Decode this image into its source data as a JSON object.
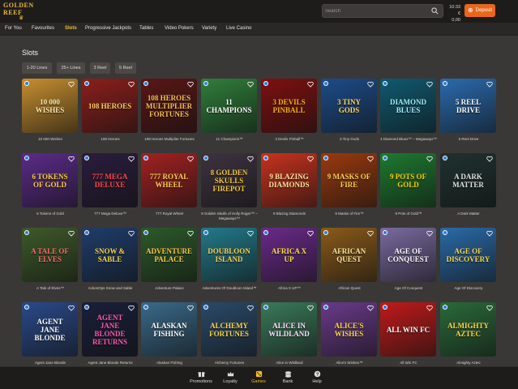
{
  "header": {
    "logo_text": "GOLDEN REEF",
    "search_placeholder": "Search",
    "balance_time": "10:33",
    "balance_amount": "€ 0,00",
    "deposit_label": "Deposit"
  },
  "nav": {
    "tabs": [
      {
        "label": "For You"
      },
      {
        "label": "Favourites"
      },
      {
        "label": "Slots",
        "active": true
      },
      {
        "label": "Progressive Jackpots"
      },
      {
        "label": "Tables"
      },
      {
        "label": "Video Pokers"
      },
      {
        "label": "Variety"
      },
      {
        "label": "Live Casino"
      }
    ]
  },
  "section": {
    "title": "Slots",
    "filters": [
      "1-20 Lines",
      "25+ Lines",
      "3 Reel",
      "5 Reel"
    ]
  },
  "games": [
    {
      "name": "10 000 Wishes",
      "art": "10 000 WISHES",
      "bg": "#c78f2f",
      "fg": "#ffe9a8"
    },
    {
      "name": "108 Heroes",
      "art": "108 HEROES",
      "bg": "#8c1f1b",
      "fg": "#ffd15a"
    },
    {
      "name": "108 Heroes Multiplier Fortunes",
      "art": "108 HEROES MULTIPLIER FORTUNES",
      "bg": "#5a1616",
      "fg": "#f6c24a"
    },
    {
      "name": "11 Champions™",
      "art": "11 CHAMPIONS",
      "bg": "#2f7f3a",
      "fg": "#ffffff"
    },
    {
      "name": "3 Devils Pinball™",
      "art": "3 DEVILS PINBALL",
      "bg": "#7e1010",
      "fg": "#ffb400"
    },
    {
      "name": "3 Tiny Gods",
      "art": "3 TINY GODS",
      "bg": "#1d4c8a",
      "fg": "#ffd86b"
    },
    {
      "name": "4 Diamond Blues™ – Megaways™",
      "art": "DIAMOND BLUES",
      "bg": "#0f5a70",
      "fg": "#9ef0ff"
    },
    {
      "name": "5 Reel Drive",
      "art": "5 REEL DRIVE",
      "bg": "#2a6bb0",
      "fg": "#ffffff"
    },
    {
      "name": "6 Tokens of Gold",
      "art": "6 TOKENS OF GOLD",
      "bg": "#5b2b8a",
      "fg": "#ffcf3a"
    },
    {
      "name": "777 Mega Deluxe™",
      "art": "777 MEGA DELUXE",
      "bg": "#2a1d3e",
      "fg": "#ff4a4a"
    },
    {
      "name": "777 Royal Wheel",
      "art": "777 ROYAL WHEEL",
      "bg": "#a32121",
      "fg": "#ffd34d"
    },
    {
      "name": "8 Golden Skulls of Holly Roger™ – Megaways™",
      "art": "8 GOLDEN SKULLS FIREPOT",
      "bg": "#3d3340",
      "fg": "#f4c542"
    },
    {
      "name": "9 Blazing Diamonds",
      "art": "9 BLAZING DIAMONDS",
      "bg": "#c8321e",
      "fg": "#ffe7a0"
    },
    {
      "name": "9 Masks of Fire™",
      "art": "9 MASKS OF FIRE",
      "bg": "#9a3a0f",
      "fg": "#ffd24a"
    },
    {
      "name": "9 Pots of Gold™",
      "art": "9 POTS OF GOLD",
      "bg": "#1e7a30",
      "fg": "#ffd400"
    },
    {
      "name": "A Dark Matter",
      "art": "A DARK MATTER",
      "bg": "#1f3230",
      "fg": "#e0e0e0"
    },
    {
      "name": "A Tale of Elves™",
      "art": "A TALE OF ELVES",
      "bg": "#3d5a2a",
      "fg": "#ff6b6b"
    },
    {
      "name": "ActionOps Snow and Sable",
      "art": "SNOW & SABLE",
      "bg": "#1f3d6b",
      "fg": "#ffd84a"
    },
    {
      "name": "Adventure Palace",
      "art": "ADVENTURE PALACE",
      "bg": "#2c5a2a",
      "fg": "#ffca3a"
    },
    {
      "name": "Adventures Of Doubloon Island™",
      "art": "DOUBLOON ISLAND",
      "bg": "#227a8a",
      "fg": "#ffd34d"
    },
    {
      "name": "Africa X UP™",
      "art": "AFRICA X UP",
      "bg": "#6a2a8a",
      "fg": "#ffe14a"
    },
    {
      "name": "African Quest",
      "art": "AFRICAN QUEST",
      "bg": "#8a5a1a",
      "fg": "#ffe7a0"
    },
    {
      "name": "Age Of Conquest",
      "art": "AGE OF CONQUEST",
      "bg": "#7a6aa0",
      "fg": "#ffffff"
    },
    {
      "name": "Age Of Discovery",
      "art": "AGE OF DISCOVERY",
      "bg": "#2a6aa8",
      "fg": "#ffd84a"
    },
    {
      "name": "Agent Jane Blonde",
      "art": "AGENT JANE BLONDE",
      "bg": "#2a4a8a",
      "fg": "#ffffff"
    },
    {
      "name": "Agent Jane Blonde Returns",
      "art": "AGENT JANE BLONDE RETURNS",
      "bg": "#1a1f3a",
      "fg": "#ff5ab0"
    },
    {
      "name": "Alaskan Fishing",
      "art": "ALASKAN FISHING",
      "bg": "#3a6a8a",
      "fg": "#ffffff"
    },
    {
      "name": "Alchemy Fortunes",
      "art": "ALCHEMY FORTUNES",
      "bg": "#2a4a6a",
      "fg": "#ffd84a"
    },
    {
      "name": "Alice in Wildland",
      "art": "ALICE IN WILDLAND",
      "bg": "#3a7a5a",
      "fg": "#ffe0ff"
    },
    {
      "name": "Alice's Wishes™",
      "art": "ALICE'S WISHES",
      "bg": "#6a3a8a",
      "fg": "#ffd84a"
    },
    {
      "name": "All Win FC",
      "art": "ALL WIN FC",
      "bg": "#c01a1a",
      "fg": "#ffffff"
    },
    {
      "name": "Almighty Aztec",
      "art": "ALMIGHTY AZTEC",
      "bg": "#2a6a3a",
      "fg": "#ffd84a"
    }
  ],
  "bottom_nav": [
    {
      "label": "Promotions",
      "icon": "gift-icon"
    },
    {
      "label": "Loyalty",
      "icon": "crown-icon"
    },
    {
      "label": "Games",
      "icon": "dice-icon",
      "active": true
    },
    {
      "label": "Bank",
      "icon": "coins-icon"
    },
    {
      "label": "Help",
      "icon": "help-icon"
    }
  ]
}
